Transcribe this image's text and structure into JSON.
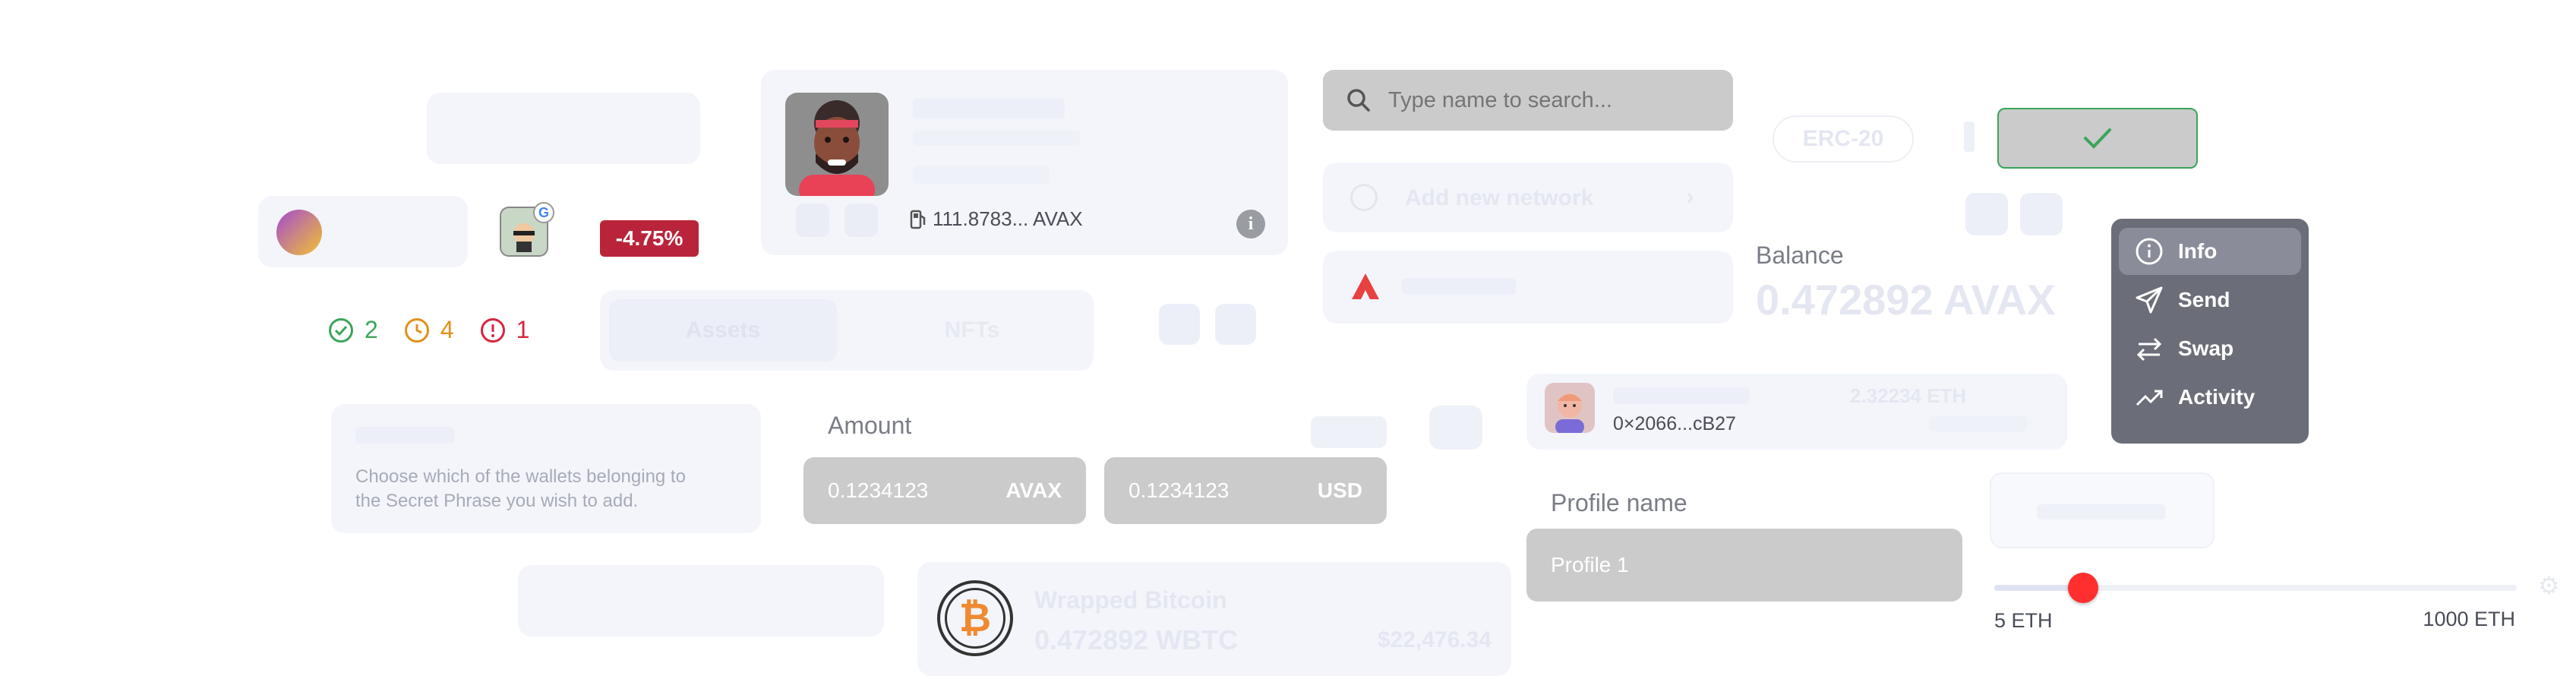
{
  "search": {
    "placeholder": "Type name to search..."
  },
  "nft_card": {
    "balance": "111.8783... AVAX"
  },
  "price_badge": {
    "change": "-4.75%"
  },
  "status_counts": {
    "success": "2",
    "pending": "4",
    "error": "1"
  },
  "amount_section": {
    "label": "Amount",
    "avax_value": "0.1234123",
    "avax_unit": "AVAX",
    "usd_value": "0.1234123",
    "usd_unit": "USD"
  },
  "wallet_hint": {
    "text": "Choose which of the wallets belonging to the Secret Phrase you wish to add."
  },
  "network_row": {
    "label": "Add new network"
  },
  "balance_section": {
    "label": "Balance",
    "value": "0.472892 AVAX"
  },
  "token_row": {
    "name": "Wrapped Bitcoin",
    "amount": "0.472892 WBTC",
    "fiat": "$22,476.34"
  },
  "account_row": {
    "address": "0×2066...cB27",
    "amount": "2.32234 ETH"
  },
  "profile": {
    "label": "Profile name",
    "value": "Profile 1"
  },
  "chip": {
    "label": "ERC-20"
  },
  "context_menu": {
    "items": [
      {
        "label": "Info",
        "icon": "info-icon"
      },
      {
        "label": "Send",
        "icon": "send-icon"
      },
      {
        "label": "Swap",
        "icon": "swap-icon"
      },
      {
        "label": "Activity",
        "icon": "activity-icon"
      }
    ]
  },
  "slider": {
    "min_label": "5 ETH",
    "max_label": "1000 ETH",
    "position": 0.17
  },
  "tabs": {
    "first": "Assets",
    "second": "NFTs"
  },
  "colors": {
    "badge_red": "#b9243a",
    "success": "#3aa55a",
    "pending": "#e0901b",
    "error": "#d7263d",
    "menu_bg": "#6b6e78",
    "slider_thumb": "#ff2f2f",
    "bitcoin": "#f08a31"
  }
}
